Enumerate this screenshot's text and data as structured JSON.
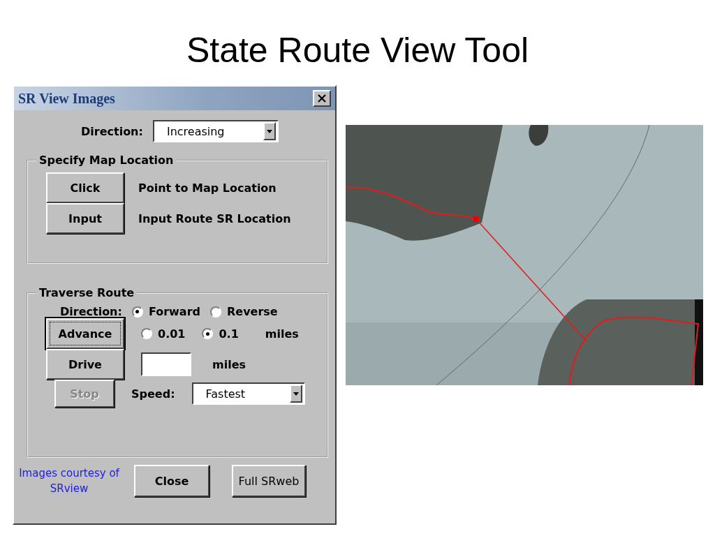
{
  "slide_title": "State Route View Tool",
  "dialog": {
    "title": "SR View Images",
    "direction": {
      "label": "Direction:",
      "value": "Increasing"
    },
    "map_location": {
      "legend": "Specify Map Location",
      "rows": [
        {
          "button": "Click",
          "description": "Point to Map Location"
        },
        {
          "button": "Input",
          "description": "Input Route SR Location"
        }
      ]
    },
    "traverse": {
      "legend": "Traverse Route",
      "direction_label": "Direction:",
      "direction_options": [
        {
          "label": "Forward",
          "selected": true
        },
        {
          "label": "Reverse",
          "selected": false
        }
      ],
      "advance_button": {
        "label": "Advance",
        "focused": true
      },
      "step_options": [
        {
          "label": "0.01",
          "selected": false
        },
        {
          "label": "0.1",
          "selected": true
        }
      ],
      "step_unit": "miles",
      "drive_button": {
        "label": "Drive",
        "disabled": false
      },
      "drive_unit": "miles",
      "stop_button": {
        "label": "Stop",
        "disabled": true
      },
      "speed": {
        "label": "Speed:",
        "value": "Fastest"
      }
    },
    "credit": "Images courtesy of SRview",
    "buttons": [
      {
        "label": "Close",
        "kind": "bold"
      },
      {
        "label": "Full SRweb",
        "kind": "plain"
      }
    ]
  }
}
